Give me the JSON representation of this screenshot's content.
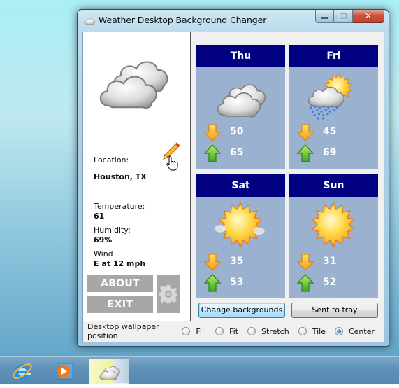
{
  "window": {
    "title": "Weather Desktop Background Changer",
    "caption_buttons": {
      "minimize": "minimize",
      "maximize": "maximize",
      "close": "✕"
    }
  },
  "current": {
    "icon": "cloudy-icon",
    "location_label": "Location:",
    "location_value": "Houston, TX",
    "temperature_label": "Temperature:",
    "temperature_value": "61",
    "humidity_label": "Humidity:",
    "humidity_value": "69%",
    "wind_label": "Wind",
    "wind_value": "E at 12 mph"
  },
  "side_buttons": {
    "about": "ABOUT",
    "exit": "EXIT"
  },
  "forecast": [
    {
      "day": "Thu",
      "icon": "cloudy-icon",
      "low": "50",
      "high": "65"
    },
    {
      "day": "Fri",
      "icon": "rain-sun-icon",
      "low": "45",
      "high": "69"
    },
    {
      "day": "Sat",
      "icon": "hazy-sun-icon",
      "low": "35",
      "high": "53"
    },
    {
      "day": "Sun",
      "icon": "sunny-icon",
      "low": "31",
      "high": "52"
    }
  ],
  "actions": {
    "change_backgrounds": "Change backgrounds",
    "sent_to_tray": "Sent to tray"
  },
  "wallpaper_position": {
    "label": "Desktop wallpaper position:",
    "options": [
      "Fill",
      "Fit",
      "Stretch",
      "Tile",
      "Center"
    ],
    "selected": "Center"
  },
  "colors": {
    "card_header": "#000080",
    "card_body": "#9ab2cf",
    "side_button": "#a7a7a7"
  },
  "taskbar": {
    "items": [
      "internet-explorer",
      "windows-media-player",
      "weather-desktop-background-changer"
    ]
  }
}
